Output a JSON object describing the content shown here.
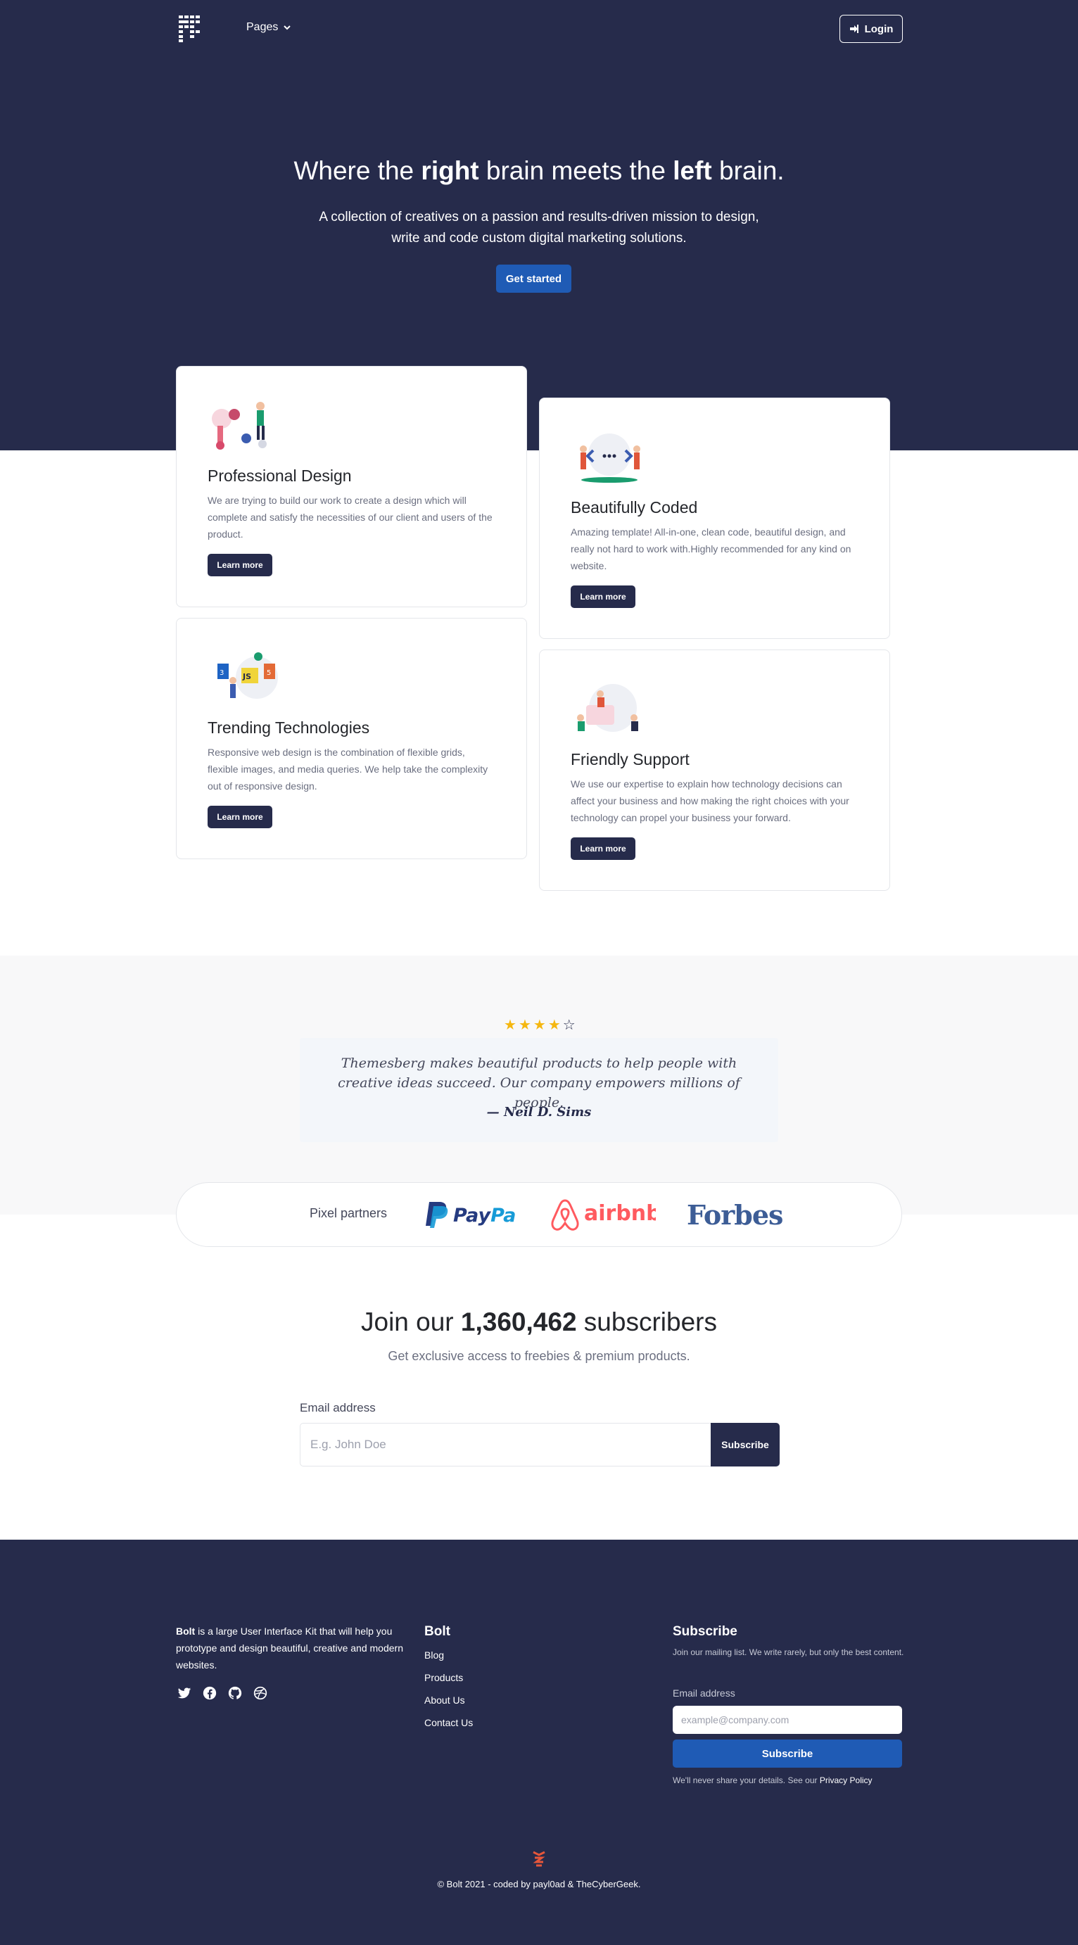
{
  "nav": {
    "pages_label": "Pages",
    "login_label": "Login"
  },
  "hero": {
    "title_pre": "Where the ",
    "title_bold1": "right",
    "title_mid": " brain meets the ",
    "title_bold2": "left",
    "title_post": " brain.",
    "subtitle": "A collection of creatives on a passion and results-driven mission to design, write and code custom digital marketing solutions.",
    "cta": "Get started"
  },
  "features": [
    {
      "title": "Professional Design",
      "description": "We are trying to build our work to create a design which will complete and satisfy the necessities of our client and users of the product.",
      "button": "Learn more",
      "icon": "designers-illustration"
    },
    {
      "title": "Beautifully Coded",
      "description": "Amazing template! All-in-one, clean code, beautiful design, and really not hard to work with.Highly recommended for any kind on website.",
      "button": "Learn more",
      "icon": "code-illustration"
    },
    {
      "title": "Trending Technologies",
      "description": "Responsive web design is the combination of flexible grids, flexible images, and media queries. We help take the complexity out of responsive design.",
      "button": "Learn more",
      "icon": "tech-stack-illustration"
    },
    {
      "title": "Friendly Support",
      "description": "We use our expertise to explain how technology decisions can affect your business and how making the right choices with your technology can propel your business your forward.",
      "button": "Learn more",
      "icon": "support-illustration"
    }
  ],
  "testimonial": {
    "rating": 4,
    "rating_max": 5,
    "quote": "Themesberg makes beautiful products to help people with creative ideas succeed. Our company empowers millions of people.",
    "author": "— Neil D. Sims"
  },
  "partners": {
    "label": "Pixel partners",
    "logos": [
      "PayPal",
      "airbnb",
      "Forbes"
    ]
  },
  "subscribe": {
    "title_pre": "Join our ",
    "count": "1,360,462",
    "title_post": " subscribers",
    "subtitle": "Get exclusive access to freebies & premium products.",
    "email_label": "Email address",
    "placeholder": "E.g. John Doe",
    "button": "Subscribe"
  },
  "footer": {
    "brand": "Bolt",
    "about": " is a large User Interface Kit that will help you prototype and design beautiful, creative and modern websites.",
    "social_icons": [
      "twitter-icon",
      "facebook-icon",
      "github-icon",
      "dribbble-icon"
    ],
    "links_title": "Bolt",
    "links": [
      "Blog",
      "Products",
      "About Us",
      "Contact Us"
    ],
    "subscribe_title": "Subscribe",
    "subscribe_text": "Join our mailing list. We write rarely, but only the best content.",
    "email_label": "Email address",
    "email_placeholder": "example@company.com",
    "button": "Subscribe",
    "privacy_text": "We'll never share your details. See our ",
    "privacy_link": "Privacy Policy",
    "copyright": "© Bolt 2021 - coded by payl0ad & TheCyberGeek."
  },
  "colors": {
    "navy": "#262b4b",
    "primary_blue": "#1f5bb5",
    "star": "#f5b710"
  }
}
